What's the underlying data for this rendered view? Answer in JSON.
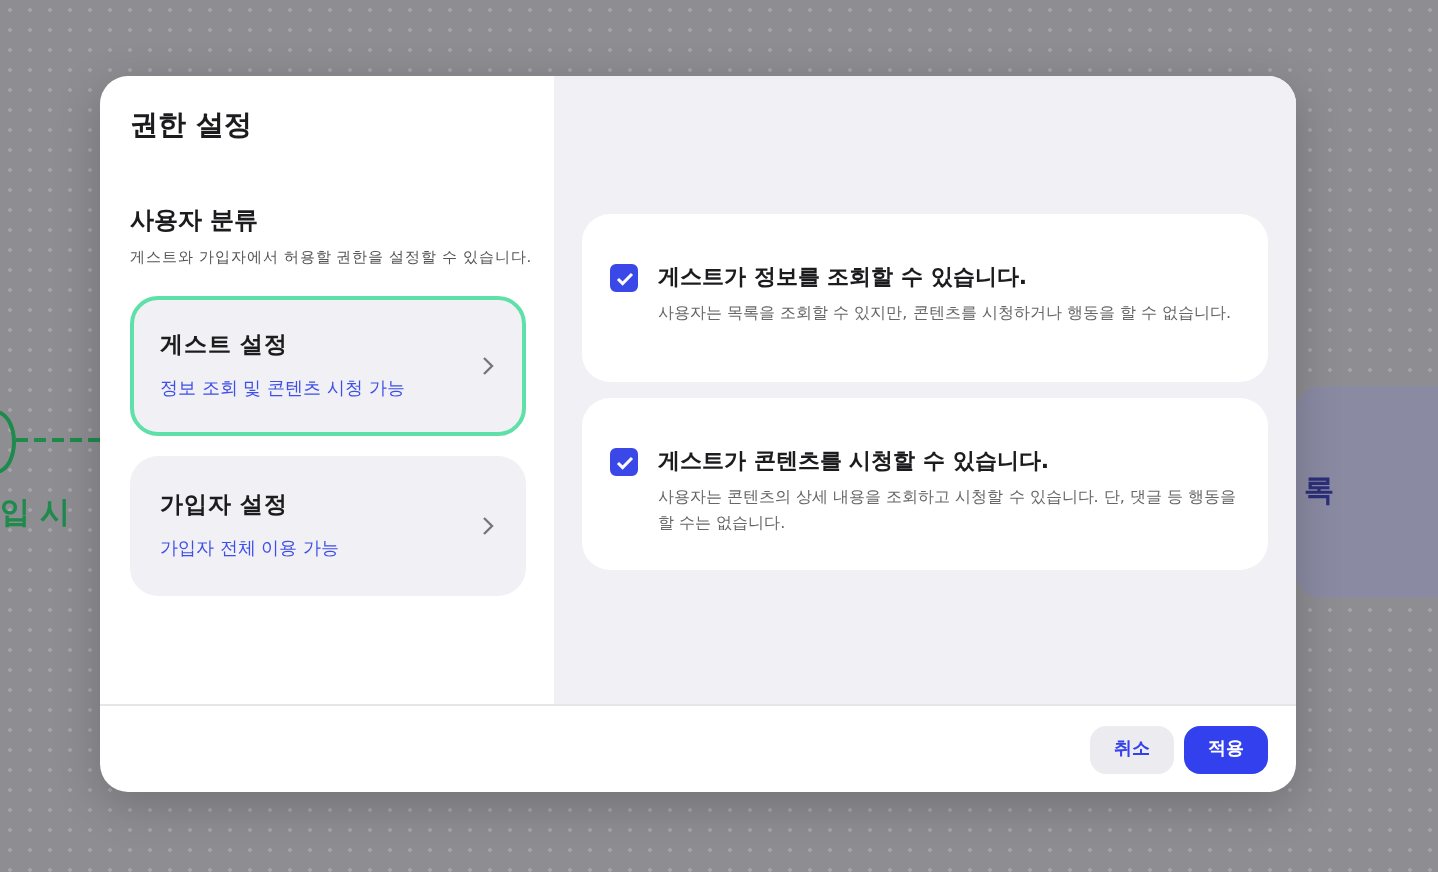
{
  "background": {
    "left_label": "입 시",
    "right_label": "록"
  },
  "dialog": {
    "title": "권한 설정",
    "section_title": "사용자 분류",
    "section_description": "게스트와 가입자에서 허용할 권한을 설정할 수 있습니다.",
    "categories": [
      {
        "title": "게스트 설정",
        "subtitle": "정보 조회 및 콘텐츠 시청 가능",
        "selected": true
      },
      {
        "title": "가입자 설정",
        "subtitle": "가입자 전체 이용 가능",
        "selected": false
      }
    ],
    "permissions": [
      {
        "title": "게스트가 정보를 조회할 수 있습니다.",
        "description": "사용자는 목록을 조회할 수 있지만, 콘텐츠를 시청하거나 행동을 할 수 없습니다.",
        "checked": true
      },
      {
        "title": "게스트가 콘텐츠를 시청할 수 있습니다.",
        "description": "사용자는 콘텐츠의 상세 내용을 조회하고 시청할 수 있습니다. 단, 댓글 등 행동을 할 수는 없습니다.",
        "checked": true
      }
    ],
    "buttons": [
      {
        "label": "취소",
        "kind": "secondary"
      },
      {
        "label": "적용",
        "kind": "primary"
      }
    ]
  }
}
